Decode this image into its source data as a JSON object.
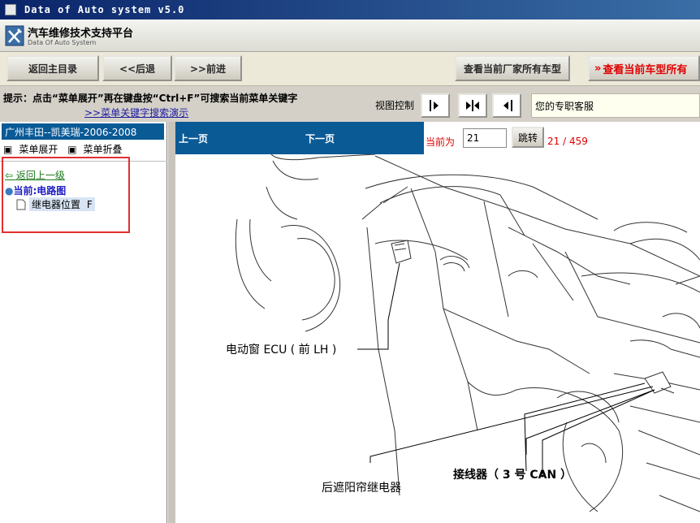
{
  "window": {
    "title": "Data of Auto system v5.0"
  },
  "app": {
    "title": "汽车维修技术支持平台",
    "subtitle": "Data Of Auto System"
  },
  "toolbar": {
    "home_label": "返回主目录",
    "back_label": "<<后退",
    "forward_label": ">>前进",
    "all_models_label": "查看当前厂家所有车型",
    "current_models_label": "查看当前车型所有"
  },
  "hint": {
    "text": "提示：点击“菜单展开”再在键盘按“Ctrl+F”可搜索当前菜单关键字",
    "demo_link": ">>菜单关键字搜索演示"
  },
  "view_control": {
    "label": "视图控制"
  },
  "service": {
    "text": "您的专职客服"
  },
  "sidebar": {
    "vehicle": "广州丰田--凯美瑞-2006-2008",
    "expand_label": "菜单展开",
    "collapse_label": "菜单折叠",
    "back_label": "返回上一级",
    "current_label": "当前:电路图",
    "node_label": "继电器位置",
    "node_suffix": "F"
  },
  "pager": {
    "prev_label": "上一页",
    "next_label": "下一页",
    "current_label": "当前为",
    "page_value": "21",
    "jump_label": "跳转",
    "page_count": "21 / 459"
  },
  "diagram": {
    "label_ecu": "电动窗 ECU ( 前 LH )",
    "label_connector": "接线器（ 3 号 CAN ）",
    "label_relay": "后遮阳帘继电器"
  }
}
